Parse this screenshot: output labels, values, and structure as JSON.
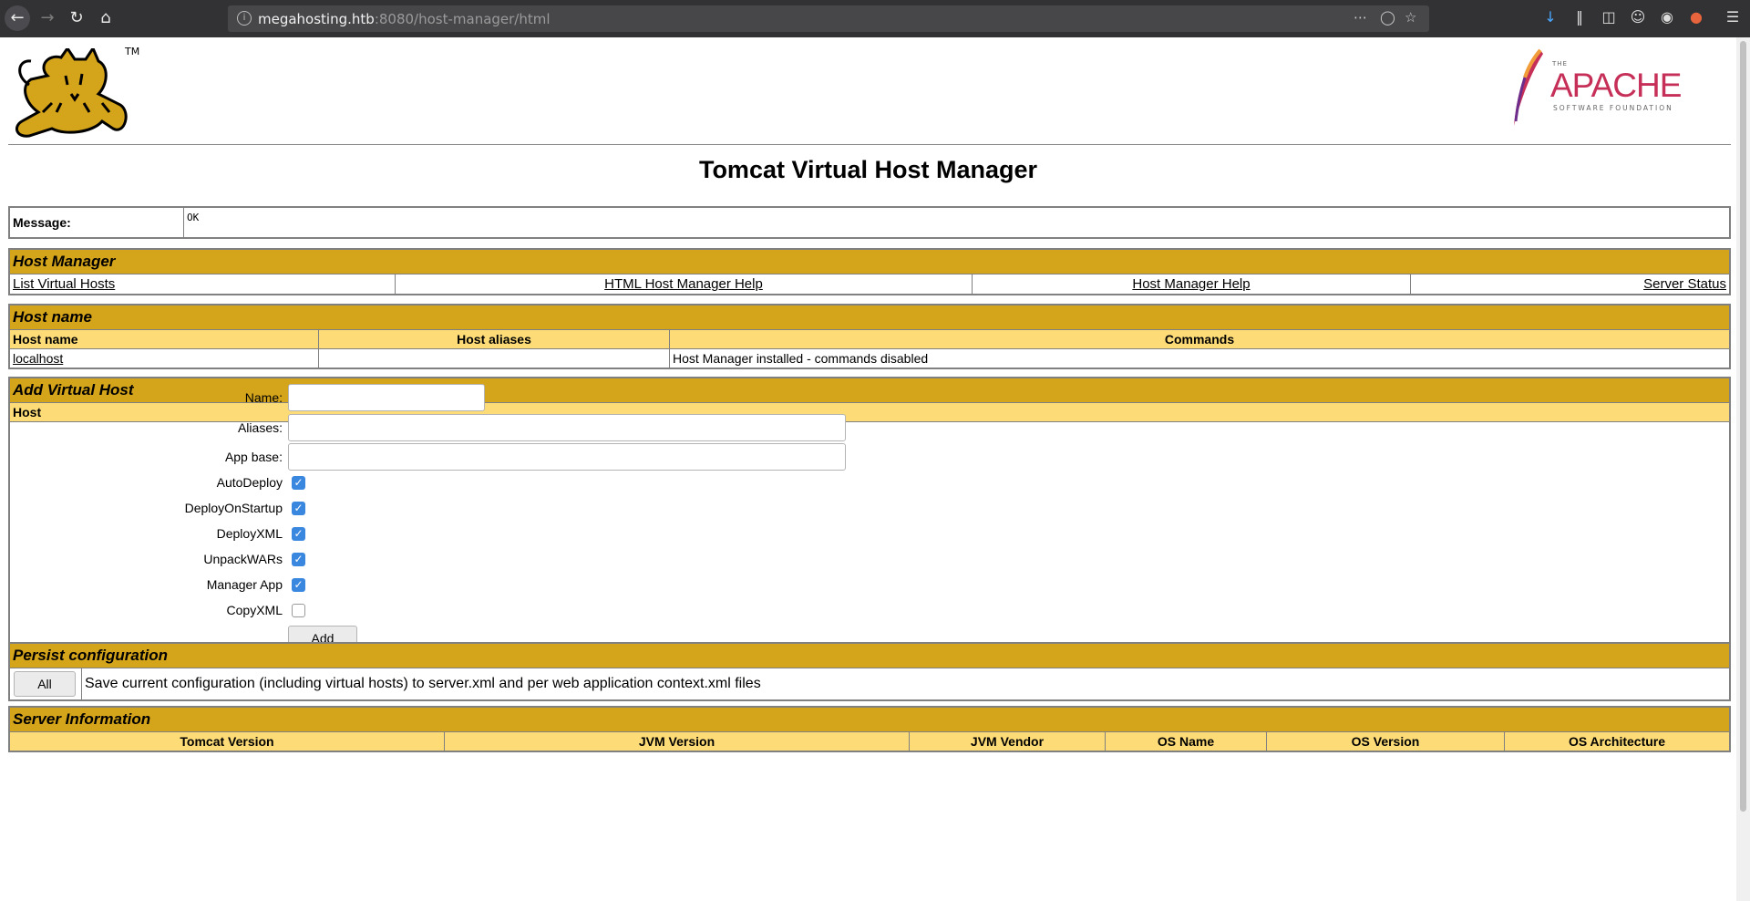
{
  "browser": {
    "url_host": "megahosting.htb",
    "url_rest": ":8080/host-manager/html"
  },
  "logo": {
    "tm": "TM",
    "apache_the": "THE",
    "apache_name": "APACHE",
    "apache_sub": "SOFTWARE FOUNDATION"
  },
  "title": "Tomcat Virtual Host Manager",
  "message": {
    "label": "Message:",
    "value": "OK"
  },
  "host_manager": {
    "title": "Host Manager",
    "links": [
      "List Virtual Hosts",
      "HTML Host Manager Help",
      "Host Manager Help",
      "Server Status"
    ]
  },
  "host_name": {
    "title": "Host name",
    "headers": [
      "Host name",
      "Host aliases",
      "Commands"
    ],
    "rows": [
      {
        "name": "localhost",
        "aliases": "",
        "commands": "Host Manager installed - commands disabled"
      }
    ]
  },
  "add_host": {
    "title": "Add Virtual Host",
    "sub": "Host",
    "name_label": "Name:",
    "aliases_label": "Aliases:",
    "appbase_label": "App base:",
    "checkboxes": [
      {
        "label": "AutoDeploy",
        "checked": true
      },
      {
        "label": "DeployOnStartup",
        "checked": true
      },
      {
        "label": "DeployXML",
        "checked": true
      },
      {
        "label": "UnpackWARs",
        "checked": true
      },
      {
        "label": "Manager App",
        "checked": true
      },
      {
        "label": "CopyXML",
        "checked": false
      }
    ],
    "add_button": "Add"
  },
  "persist": {
    "title": "Persist configuration",
    "button": "All",
    "text": "Save current configuration (including virtual hosts) to server.xml and per web application context.xml files"
  },
  "server_info": {
    "title": "Server Information",
    "headers": [
      "Tomcat Version",
      "JVM Version",
      "JVM Vendor",
      "OS Name",
      "OS Version",
      "OS Architecture"
    ]
  },
  "colors": {
    "section": "#d4a41b",
    "subheader": "#fddc78",
    "checkbox": "#3a87e0"
  }
}
